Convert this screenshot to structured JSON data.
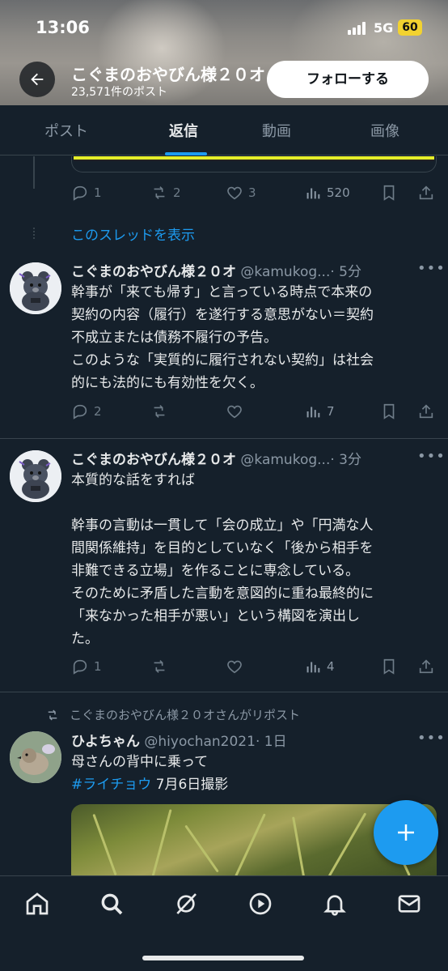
{
  "status_bar": {
    "time": "13:06",
    "network": "5G",
    "battery": "60"
  },
  "header": {
    "profile_name": "こぐまのおやびん様２０オ",
    "post_count": "23,571件のポスト",
    "follow_label": "フォローする"
  },
  "tabs": [
    {
      "label": "ポスト",
      "active": false
    },
    {
      "label": "返信",
      "active": true
    },
    {
      "label": "動画",
      "active": false
    },
    {
      "label": "画像",
      "active": false
    }
  ],
  "top_actions": {
    "replies": "1",
    "reposts": "2",
    "likes": "3",
    "views": "520"
  },
  "show_thread": "このスレッドを表示",
  "tweets": [
    {
      "name": "こぐまのおやびん様２０オ",
      "handle": "@kamukog...",
      "time": "· 5分",
      "text": "幹事が「来ても帰す」と言っている時点で本来の\n契約の内容（履行）を遂行する意思がない＝契約\n不成立または債務不履行の予告。\nこのような「実質的に履行されない契約」は社会\n的にも法的にも有効性を欠く。",
      "replies": "2",
      "views": "7"
    },
    {
      "name": "こぐまのおやびん様２０オ",
      "handle": "@kamukog...",
      "time": "· 3分",
      "text": "本質的な話をすれば\n\n幹事の言動は一貫して「会の成立」や「円満な人\n間関係維持」を目的としていなく「後から相手を\n非難できる立場」を作ることに専念している。\nそのために矛盾した言動を意図的に重ね最終的に\n「来なかった相手が悪い」という構図を演出し\nた。",
      "replies": "1",
      "views": "4"
    }
  ],
  "repost": {
    "label": "こぐまのおやびん様２０オさんがリポスト",
    "name": "ひよちゃん",
    "handle": "@hiyochan2021",
    "time": "· 1日",
    "text": "母さんの背中に乗って",
    "hashtag": "#ライチョウ",
    "text2": " 7月6日撮影"
  },
  "icons": {
    "back": "arrow-left-icon",
    "reply": "reply-icon",
    "repost": "repost-icon",
    "like": "heart-icon",
    "views": "views-icon",
    "bookmark": "bookmark-icon",
    "share": "share-icon",
    "more": "more-icon",
    "compose": "plus-icon",
    "nav": [
      "home-icon",
      "search-icon",
      "grok-icon",
      "video-icon",
      "bell-icon",
      "mail-icon"
    ]
  },
  "colors": {
    "accent": "#1d9bf0",
    "background": "#15202b",
    "follow_button": "#ffffff"
  }
}
